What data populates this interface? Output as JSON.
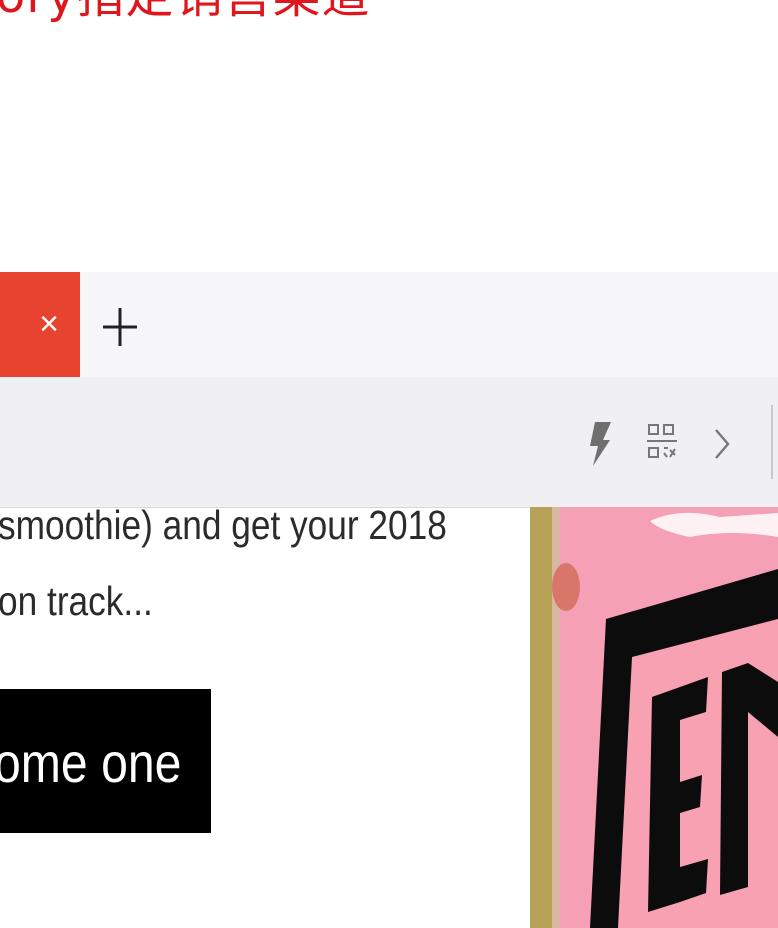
{
  "caption": {
    "text": "ory指定销售渠道",
    "color": "#e0161d"
  },
  "browser": {
    "active_tab": {
      "color": "#e8432f",
      "close_icon": "close-icon",
      "close_glyph": "×"
    },
    "new_tab_icon": "plus-icon",
    "toolbar_icons": [
      "lightning-bolt-icon",
      "qr-code-icon",
      "chevron-right-icon"
    ]
  },
  "content": {
    "line_1": "smoothie) and get your 2018",
    "line_2": "on track...",
    "cta_label": "ome one"
  },
  "product_image": {
    "description_icon": "product-package-image",
    "primary_color": "#f5a0b5"
  }
}
